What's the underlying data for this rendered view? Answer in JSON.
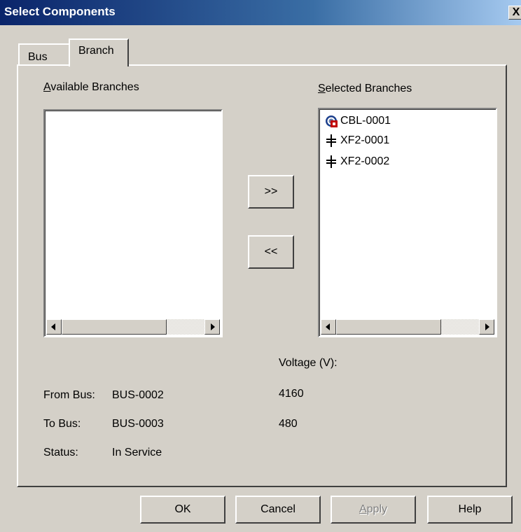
{
  "window": {
    "title": "Select Components",
    "close_glyph": "X"
  },
  "tabs": [
    {
      "label": "Bus",
      "active": false
    },
    {
      "label": "Branch",
      "active": true
    }
  ],
  "available": {
    "label_mnemonic": "A",
    "label_rest": "vailable Branches",
    "items": []
  },
  "selected": {
    "label_mnemonic": "S",
    "label_rest": "elected Branches",
    "items": [
      {
        "label": "CBL-0001",
        "icon": "cable-icon"
      },
      {
        "label": "XF2-0001",
        "icon": "transformer-icon"
      },
      {
        "label": "XF2-0002",
        "icon": "transformer-icon"
      }
    ]
  },
  "move_buttons": {
    "add": ">>",
    "remove": "<<"
  },
  "info": {
    "voltage_header": "Voltage (V):",
    "from_bus": {
      "label": "From Bus:",
      "value": "BUS-0002",
      "voltage": "4160"
    },
    "to_bus": {
      "label": "To Bus:",
      "value": "BUS-0003",
      "voltage": "480"
    },
    "status": {
      "label": "Status:",
      "value": "In Service"
    }
  },
  "buttons": {
    "ok": "OK",
    "cancel": "Cancel",
    "apply_mnemonic": "A",
    "apply_rest": "pply",
    "help": "Help"
  },
  "colors": {
    "titlebar_start": "#0a246a",
    "titlebar_end": "#a6caf0",
    "face": "#d4d0c8",
    "cable_icon_red": "#c00000",
    "cable_icon_blue": "#1c3f8c"
  }
}
